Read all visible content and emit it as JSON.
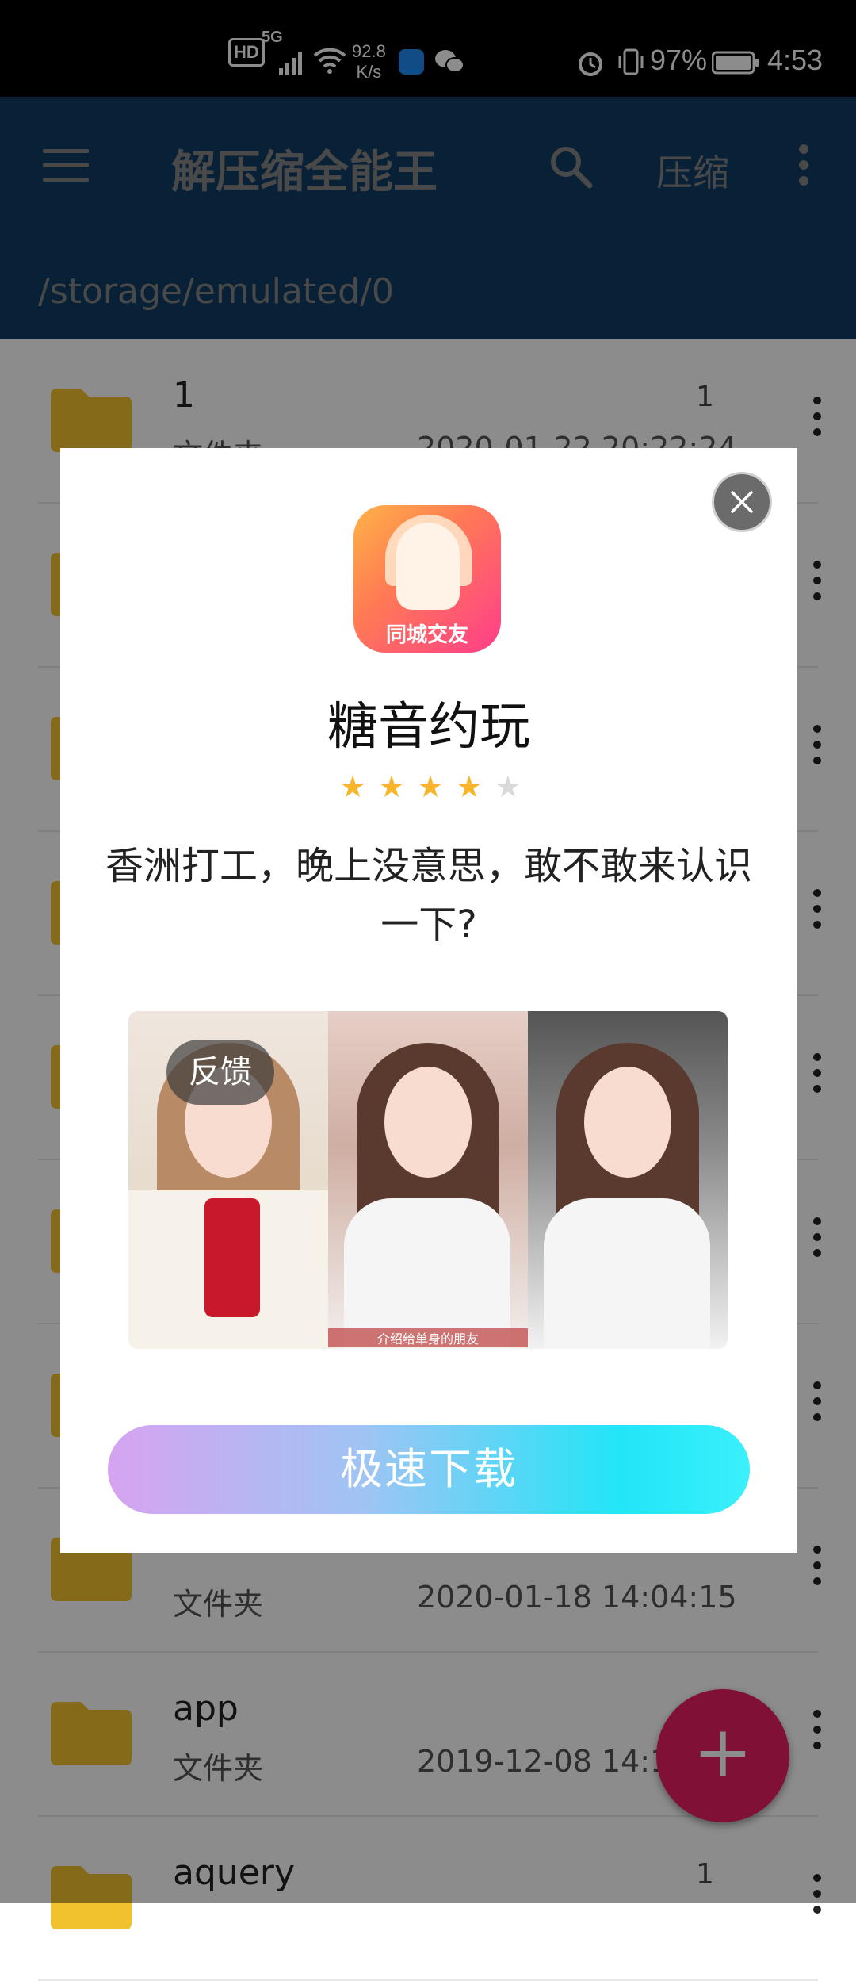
{
  "status_bar": {
    "hd": "HD",
    "net": "5G",
    "speed_value": "92.8",
    "speed_unit": "K/s",
    "battery_pct": "97%",
    "time": "4:53"
  },
  "app_bar": {
    "title": "解压缩全能王",
    "compress_label": "压缩",
    "path": "/storage/emulated/0"
  },
  "files": [
    {
      "name": "1",
      "type": "文件夹",
      "count": "1",
      "date": "2020-01-22 20:22:24"
    },
    {
      "name": "",
      "type": "",
      "count": "",
      "date": ""
    },
    {
      "name": "",
      "type": "",
      "count": "",
      "date": ""
    },
    {
      "name": "",
      "type": "",
      "count": "",
      "date": ""
    },
    {
      "name": "",
      "type": "",
      "count": "",
      "date": ""
    },
    {
      "name": "",
      "type": "",
      "count": "",
      "date": ""
    },
    {
      "name": "",
      "type": "",
      "count": "",
      "date": ""
    },
    {
      "name": "",
      "type": "文件夹",
      "count": "",
      "date": "2020-01-18 14:04:15"
    },
    {
      "name": "app",
      "type": "文件夹",
      "count": "",
      "date": "2019-12-08 14:10"
    },
    {
      "name": "aquery",
      "type": "",
      "count": "1",
      "date": ""
    }
  ],
  "fab_label": "+",
  "ad": {
    "icon_label": "同城交友",
    "name": "糖音约玩",
    "rating": 4,
    "rating_max": 5,
    "description": "香洲打工，晚上没意思，敢不敢来认识一下?",
    "feedback_label": "反馈",
    "photo_caption": "介绍给单身的朋友",
    "download_label": "极速下载"
  },
  "colors": {
    "app_bar": "#1e73be",
    "fab": "#e91e63",
    "star_on": "#f7b52c",
    "star_off": "#d9d9d9"
  }
}
